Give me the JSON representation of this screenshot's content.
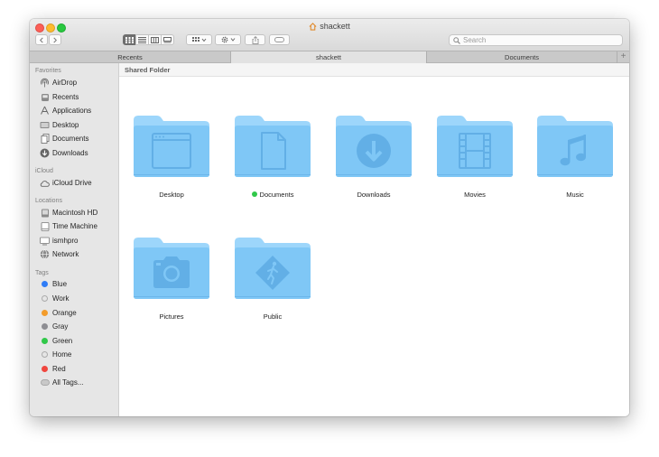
{
  "window": {
    "title": "shackett"
  },
  "toolbar": {
    "back_icon": "chevron-left-icon",
    "forward_icon": "chevron-right-icon",
    "view_modes": [
      "icon-view-icon",
      "list-view-icon",
      "column-view-icon",
      "gallery-view-icon"
    ],
    "active_view": "icon-view-icon",
    "group_icon": "group-icon",
    "action_icon": "gear-icon",
    "share_icon": "share-icon",
    "tag_icon": "tag-icon"
  },
  "search": {
    "placeholder": "Search",
    "value": ""
  },
  "tabs": [
    {
      "label": "Recents",
      "active": false
    },
    {
      "label": "shackett",
      "active": true
    },
    {
      "label": "Documents",
      "active": false
    }
  ],
  "sidebar": {
    "sections": [
      {
        "title": "Favorites",
        "items": [
          {
            "label": "AirDrop",
            "icon": "airdrop-icon"
          },
          {
            "label": "Recents",
            "icon": "recents-icon"
          },
          {
            "label": "Applications",
            "icon": "applications-icon"
          },
          {
            "label": "Desktop",
            "icon": "desktop-icon"
          },
          {
            "label": "Documents",
            "icon": "documents-icon"
          },
          {
            "label": "Downloads",
            "icon": "downloads-icon"
          }
        ]
      },
      {
        "title": "iCloud",
        "items": [
          {
            "label": "iCloud Drive",
            "icon": "cloud-icon"
          }
        ]
      },
      {
        "title": "Locations",
        "items": [
          {
            "label": "Macintosh HD",
            "icon": "hard-drive-icon"
          },
          {
            "label": "Time Machine",
            "icon": "time-machine-icon"
          },
          {
            "label": "ismhpro",
            "icon": "computer-icon"
          },
          {
            "label": "Network",
            "icon": "network-icon"
          }
        ]
      },
      {
        "title": "Tags",
        "items": [
          {
            "label": "Blue",
            "color": "#2f7cf6"
          },
          {
            "label": "Work",
            "color": ""
          },
          {
            "label": "Orange",
            "color": "#f39c2b"
          },
          {
            "label": "Gray",
            "color": "#8e8e93"
          },
          {
            "label": "Green",
            "color": "#30c849"
          },
          {
            "label": "Home",
            "color": ""
          },
          {
            "label": "Red",
            "color": "#f0463e"
          },
          {
            "label": "All Tags...",
            "icon": "all-tags-icon"
          }
        ]
      }
    ]
  },
  "pathbar": {
    "label": "Shared Folder"
  },
  "folders": [
    {
      "name": "Desktop",
      "icon": "desktop-window-glyph"
    },
    {
      "name": "Documents",
      "icon": "document-glyph",
      "tag_color": "#30c849"
    },
    {
      "name": "Downloads",
      "icon": "download-arrow-glyph"
    },
    {
      "name": "Movies",
      "icon": "film-strip-glyph"
    },
    {
      "name": "Music",
      "icon": "music-note-glyph"
    },
    {
      "name": "Pictures",
      "icon": "camera-glyph"
    },
    {
      "name": "Public",
      "icon": "walking-person-sign-glyph"
    }
  ],
  "colors": {
    "folder_body": "#7fc7f6",
    "folder_tab": "#9dd6fb",
    "folder_glyph": "#62afe6",
    "sidebar_bg": "#e6e6e6"
  }
}
